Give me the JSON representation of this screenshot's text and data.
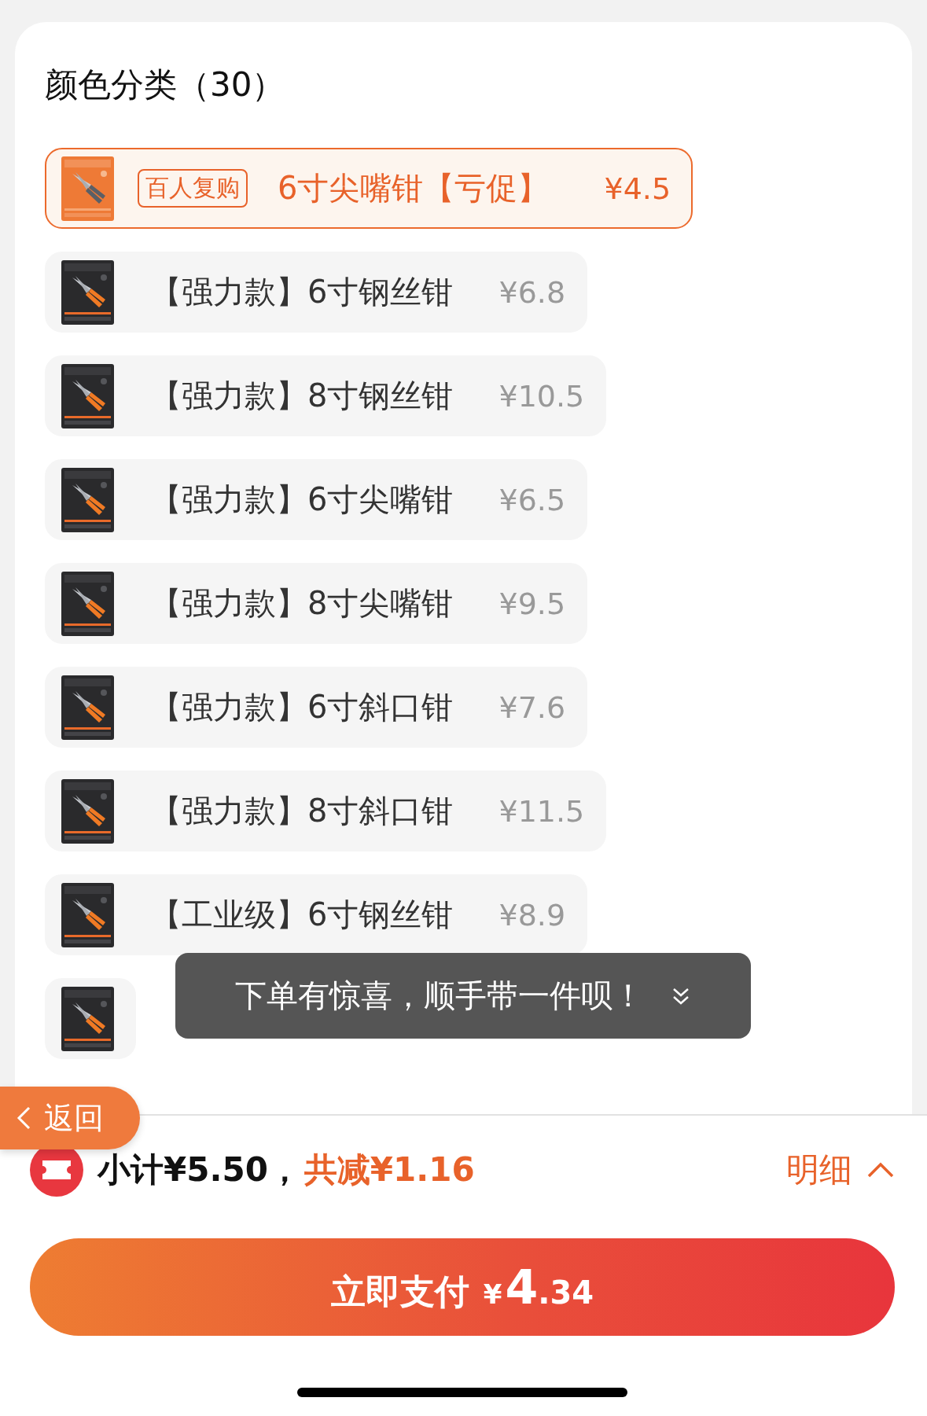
{
  "header": {
    "title": "颜色分类（30）"
  },
  "options": [
    {
      "badge": "百人复购",
      "title": "6寸尖嘴钳【亏促】",
      "price": "¥4.5",
      "selected": true
    },
    {
      "title": "【强力款】6寸钢丝钳",
      "price": "¥6.8",
      "selected": false
    },
    {
      "title": "【强力款】8寸钢丝钳",
      "price": "¥10.5",
      "selected": false
    },
    {
      "title": "【强力款】6寸尖嘴钳",
      "price": "¥6.5",
      "selected": false
    },
    {
      "title": "【强力款】8寸尖嘴钳",
      "price": "¥9.5",
      "selected": false
    },
    {
      "title": "【强力款】6寸斜口钳",
      "price": "¥7.6",
      "selected": false
    },
    {
      "title": "【强力款】8寸斜口钳",
      "price": "¥11.5",
      "selected": false
    },
    {
      "title": "【工业级】6寸钢丝钳",
      "price": "¥8.9",
      "selected": false
    },
    {
      "selected": false
    }
  ],
  "toast": {
    "text": "下单有惊喜，顺手带一件呗！"
  },
  "back_button": {
    "label": "返回"
  },
  "summary": {
    "subtotal": "小计¥5.50，",
    "discount": "共减¥1.16",
    "details_link": "明细"
  },
  "pay_button": {
    "label": "立即支付",
    "currency": "¥",
    "amount_integer": "4",
    "amount_decimal": ".34"
  }
}
